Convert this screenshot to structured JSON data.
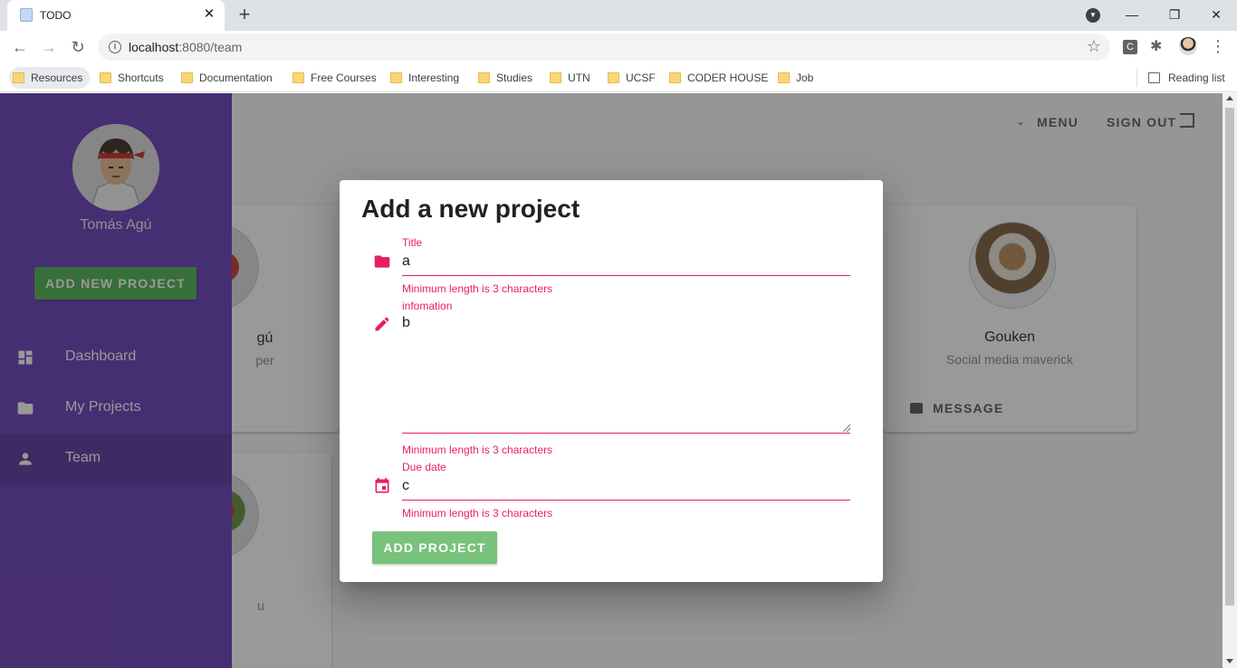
{
  "browser": {
    "tab": {
      "title": "TODO",
      "close": "✕"
    },
    "new_tab": "+",
    "window": {
      "minimize": "—",
      "restore": "❐",
      "close": "✕"
    },
    "nav": {
      "back": "←",
      "forward": "→",
      "reload": "↻"
    },
    "address": {
      "host": "localhost",
      "rest": ":8080/team"
    },
    "star": "☆",
    "extension_letter": "C",
    "extension_puzzle": "✱",
    "menu": "⋮",
    "bookmarks": [
      "Resources",
      "Shortcuts",
      "Documentation",
      "Free Courses",
      "Interesting",
      "Studies",
      "UTN",
      "UCSF",
      "CODER HOUSE",
      "Job"
    ],
    "reading_list": "Reading list"
  },
  "app": {
    "appbar": {
      "menu_label": "MENU",
      "signout_label": "SIGN OUT",
      "chevron": "⌄"
    },
    "drawer": {
      "user_name": "Tomás Agú",
      "add_button": "ADD NEW PROJECT",
      "nav": [
        {
          "label": "Dashboard",
          "icon": "dashboard-icon"
        },
        {
          "label": "My Projects",
          "icon": "folder-icon"
        },
        {
          "label": "Team",
          "icon": "person-icon"
        }
      ]
    },
    "team_cards": [
      {
        "name": "gú",
        "role": "per",
        "button": ""
      },
      {
        "name": "Gouken",
        "role": "Social media maverick",
        "button": "MESSAGE"
      },
      {
        "name": "",
        "role": "u",
        "button": ""
      }
    ]
  },
  "dialog": {
    "title": "Add a new project",
    "fields": {
      "title": {
        "label": "Title",
        "value": "a",
        "error": "Minimum length is 3 characters"
      },
      "information": {
        "label": "infomation",
        "value": "b",
        "error": "Minimum length is 3 characters"
      },
      "due_date": {
        "label": "Due date",
        "value": "c",
        "error": "Minimum length is 3 characters"
      }
    },
    "submit_label": "ADD PROJECT"
  },
  "colors": {
    "drawer": "#673ab7",
    "accent_error": "#e91e63",
    "success_button": "#4caf50"
  }
}
